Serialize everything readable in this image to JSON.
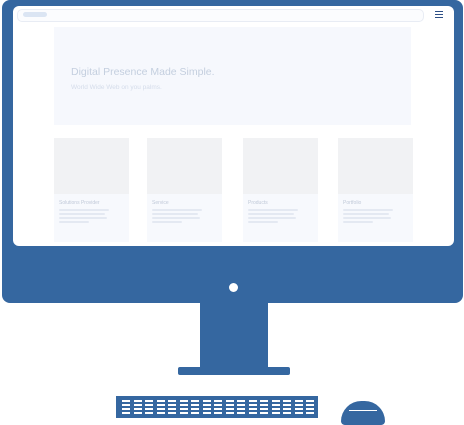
{
  "colors": {
    "device": "#3567a0",
    "screen": "#ffffff",
    "hero_background": "#f6f8fd",
    "card_image": "#f1f2f4",
    "menu_icon": "#2d4f86"
  },
  "website": {
    "menu_icon": "hamburger-menu-icon",
    "hero": {
      "title": "Digital Presence Made Simple.",
      "subtitle": "World Wide Web on you palms."
    },
    "cards": [
      {
        "title": "Solutions Provider"
      },
      {
        "title": "Service"
      },
      {
        "title": "Products"
      },
      {
        "title": "Portfolio"
      }
    ]
  }
}
